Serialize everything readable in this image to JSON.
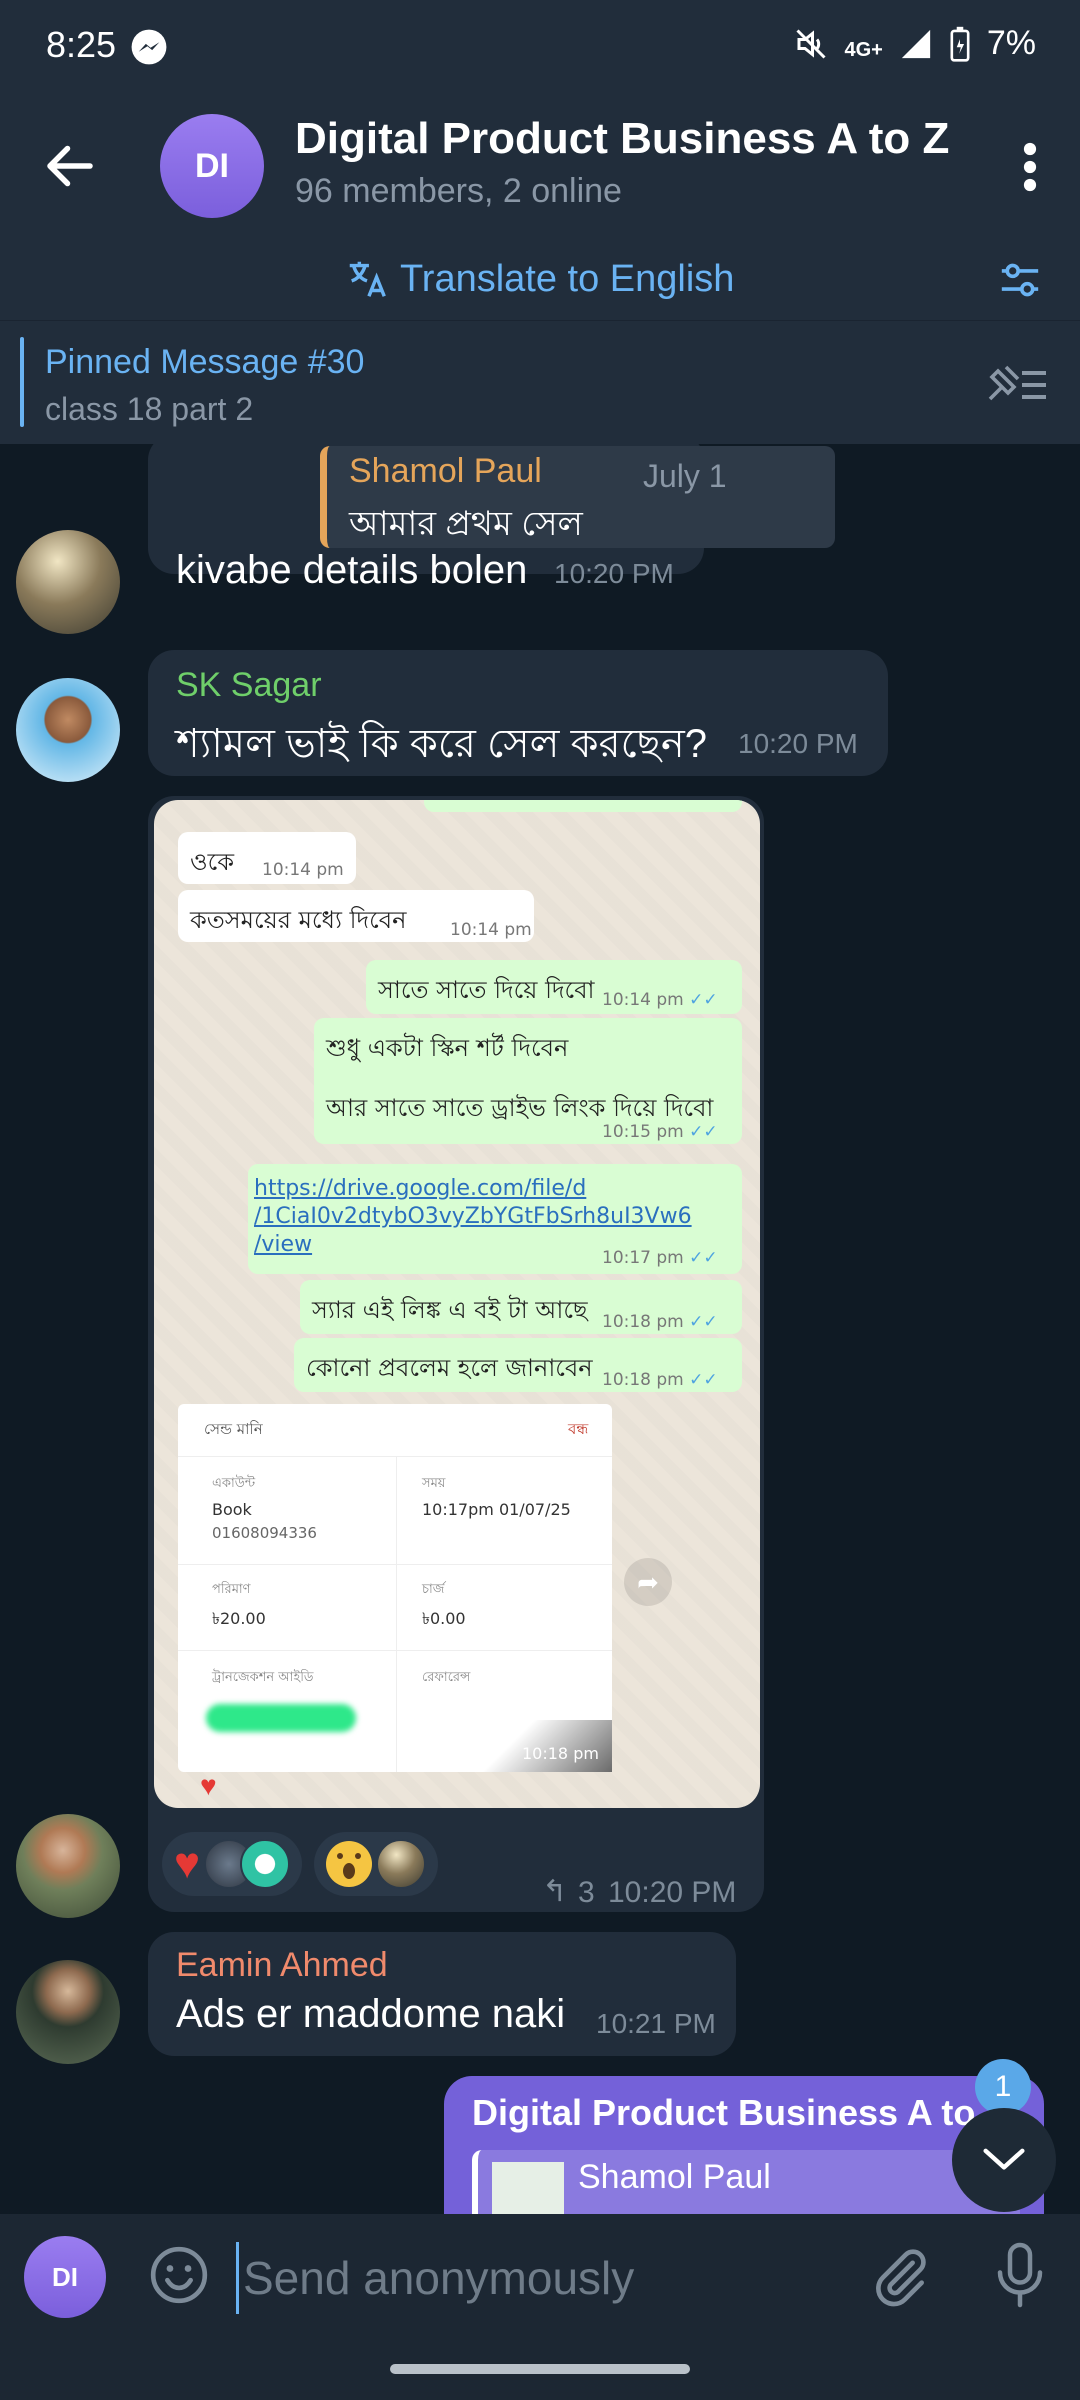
{
  "status_bar": {
    "time": "8:25",
    "network": "4G+",
    "battery": "7%"
  },
  "header": {
    "avatar_initials": "DI",
    "title": "Digital Product Business A to Z",
    "subtitle": "96 members, 2 online"
  },
  "translate_bar": {
    "label": "Translate to English"
  },
  "pinned": {
    "title": "Pinned Message #30",
    "text": "class 18 part 2"
  },
  "messages": {
    "m1": {
      "reply_name": "Shamol Paul",
      "reply_date": "July 1",
      "reply_text": "আমার প্রথম সেল",
      "text": "kivabe details bolen",
      "time": "10:20 PM"
    },
    "m2": {
      "sender": "SK Sagar",
      "text": "শ্যামল ভাই কি করে সেল করছেন?",
      "time": "10:20 PM"
    },
    "m3": {
      "screenshot": {
        "msgs": [
          {
            "text": "ওকে",
            "time": "10:14 pm"
          },
          {
            "text": "কতসময়ের মধ্যে দিবেন",
            "time": "10:14 pm"
          },
          {
            "text": "সাতে সাতে দিয়ে দিবো",
            "time": "10:14 pm"
          },
          {
            "text": "শুধু একটা স্কিন শর্ট দিবেন",
            "text2": "আর সাতে সাতে ড্রাইভ লিংক দিয়ে দিবো",
            "time": "10:15 pm"
          },
          {
            "text": "https://drive.google.com/file/d/1CiaI0v2dtybO3vyZbYGtFbSrh8uI3Vw6/view",
            "line1": "https://drive.google.com/file/d",
            "line2": "/1CiaI0v2dtybO3vyZbYGtFbSrh8uI3Vw6",
            "line3": "/view",
            "time": "10:17 pm"
          },
          {
            "text": "স্যার এই লিঙ্ক এ বই টা আছে",
            "time": "10:18 pm"
          },
          {
            "text": "কোনো প্রবলেম হলে জানাবেন",
            "time": "10:18 pm"
          }
        ],
        "card": {
          "title": "সেন্ড মানি",
          "close": "বন্ধ",
          "account_label": "একাউন্ট",
          "account_name": "Book",
          "account_number": "01608094336",
          "time_label": "সময়",
          "time_value": "10:17pm 01/07/25",
          "amount_label": "পরিমাণ",
          "amount_value": "৳20.00",
          "charge_label": "চার্জ",
          "charge_value": "৳0.00",
          "trx_label": "ট্রানজেকশন আইডি",
          "ref_label": "রেফারেন্স",
          "time_stamp": "10:18 pm"
        }
      },
      "reactions": [
        {
          "emoji": "❤️"
        },
        {
          "emoji": "😱"
        }
      ],
      "reply_count": "3",
      "time": "10:20 PM"
    },
    "m4": {
      "sender": "Eamin Ahmed",
      "text": "Ads er maddome naki",
      "time": "10:21 PM"
    },
    "m5": {
      "group": "Digital Product Business A to Z",
      "reply_name": "Shamol Paul"
    }
  },
  "scroll_badge": "1",
  "input": {
    "avatar_initials": "DI",
    "placeholder": "Send anonymously"
  },
  "colors": {
    "accent": "#6ab3f3",
    "header_bg": "#212d3b",
    "chat_bg": "#0f1a24",
    "bubble_bg": "#212d3b",
    "own_bubble": "#7461d9",
    "sagar": "#6fcf6a",
    "shamol": "#e5a55a",
    "eamin": "#f08a6c"
  }
}
